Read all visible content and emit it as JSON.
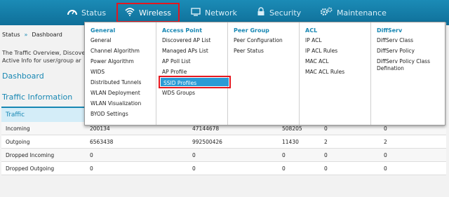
{
  "nav": {
    "tabs": [
      {
        "label": "Status",
        "icon": "speedometer-icon"
      },
      {
        "label": "Wireless",
        "icon": "wifi-icon"
      },
      {
        "label": "Network",
        "icon": "network-icon"
      },
      {
        "label": "Security",
        "icon": "lock-icon"
      },
      {
        "label": "Maintenance",
        "icon": "gears-icon"
      }
    ],
    "active_tab": "Wireless"
  },
  "breadcrumb": {
    "root": "Status",
    "current": "Dashboard"
  },
  "intro": {
    "line1": "The Traffic Overview, Discove",
    "line2": "Active Info for user/group ar"
  },
  "sections": {
    "dashboard": "Dashboard",
    "traffic": "Traffic Information"
  },
  "traffic_table": {
    "header": "Traffic",
    "rows": [
      {
        "label": "Incoming",
        "values": [
          "200134",
          "47144678",
          "508205",
          "0",
          "0"
        ]
      },
      {
        "label": "Outgoing",
        "values": [
          "6563438",
          "992500426",
          "11430",
          "2",
          "2"
        ]
      },
      {
        "label": "Dropped Incoming",
        "values": [
          "0",
          "0",
          "0",
          "0",
          "0"
        ]
      },
      {
        "label": "Dropped Outgoing",
        "values": [
          "0",
          "0",
          "0",
          "0",
          "0"
        ]
      }
    ]
  },
  "menu": {
    "columns": [
      {
        "title": "General",
        "items": [
          "General",
          "Channel Algorithm",
          "Power Algorithm",
          "WIDS",
          "Distributed Tunnels",
          "WLAN Deployment",
          "WLAN Visualization",
          "BYOD Settings"
        ]
      },
      {
        "title": "Access Point",
        "items": [
          "Discovered AP List",
          "Managed APs List",
          "AP Poll List",
          "AP Profile",
          "SSID Profiles",
          "WDS Groups"
        ]
      },
      {
        "title": "Peer Group",
        "items": [
          "Peer Configuration",
          "Peer Status"
        ]
      },
      {
        "title": "ACL",
        "items": [
          "IP ACL",
          "IP ACL Rules",
          "MAC ACL",
          "MAC ACL Rules"
        ]
      },
      {
        "title": "DiffServ",
        "items": [
          "DiffServ Class",
          "DiffServ Policy",
          "DiffServ Policy Class Defination"
        ]
      }
    ],
    "highlighted_item": "SSID Profiles"
  },
  "colors": {
    "accent": "#1787b3",
    "highlight": "#e5171f",
    "selection": "#2a9bd6"
  }
}
